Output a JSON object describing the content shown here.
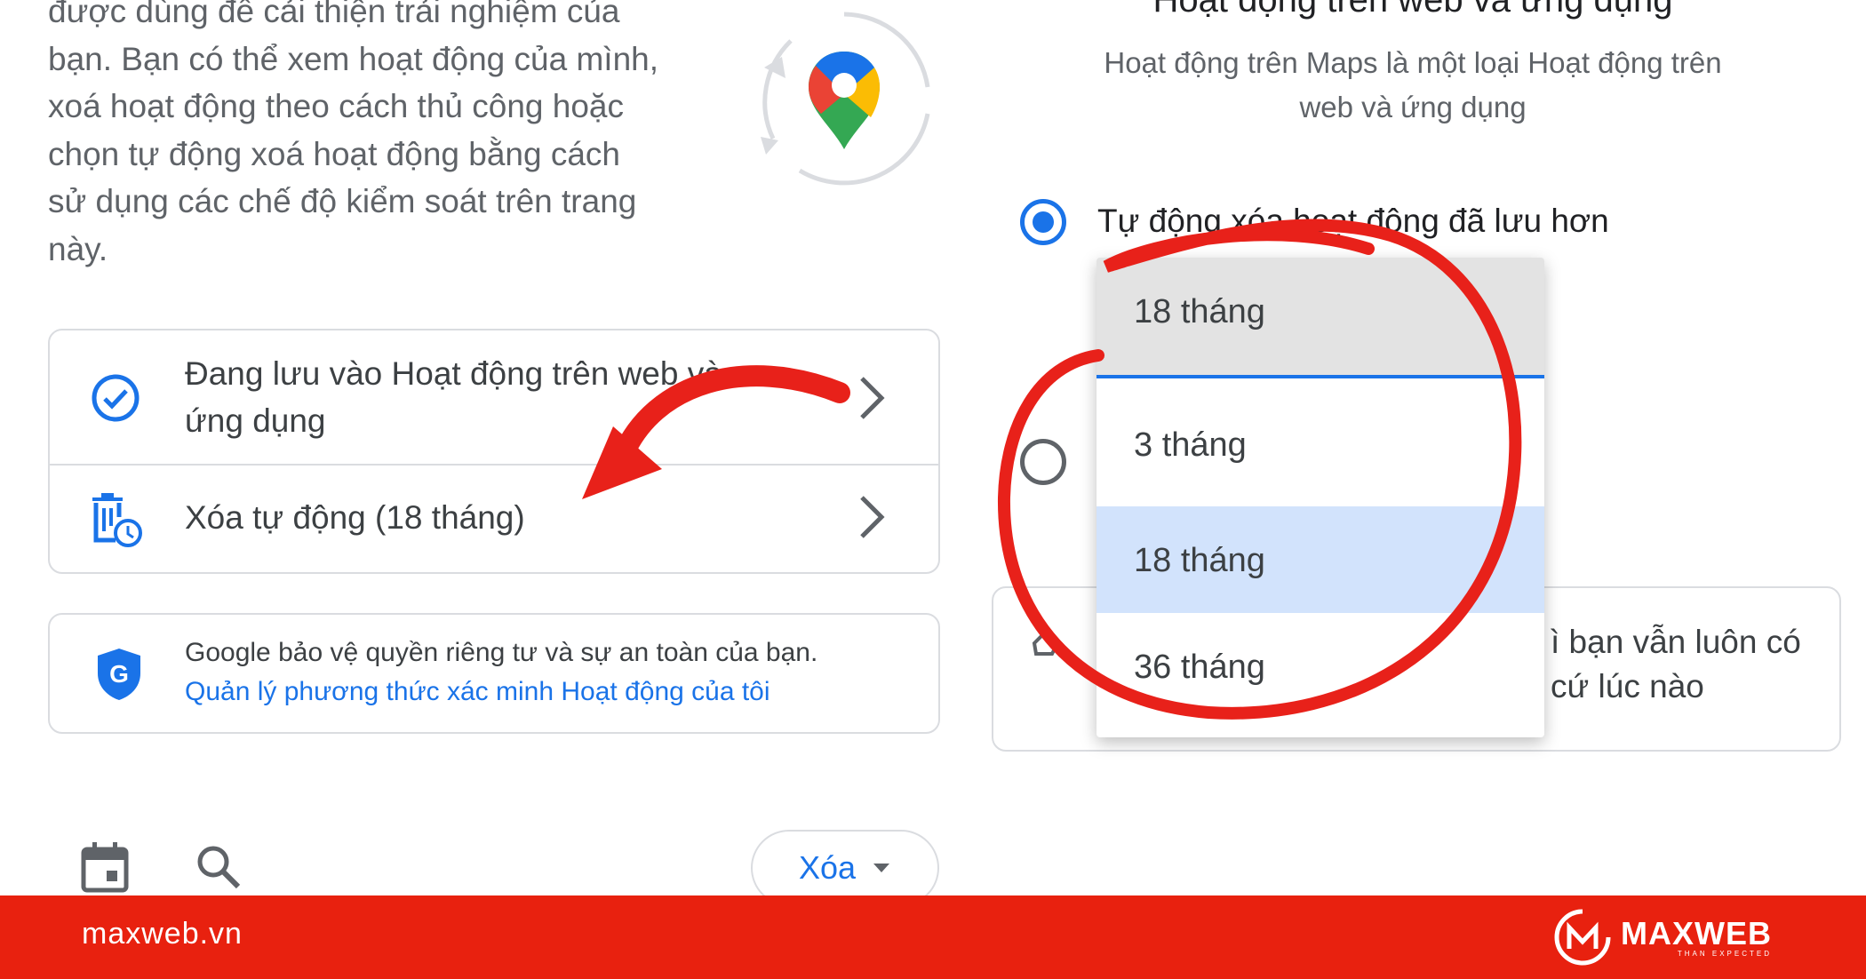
{
  "intro": {
    "text": "được dùng để cải thiện trải nghiệm của\nbạn. Bạn có thể xem hoạt động của mình,\nxoá hoạt động theo cách thủ công hoặc\nchọn tự động xoá hoạt động bằng cách\nsử dụng các chế độ kiểm soát trên trang\nnày."
  },
  "settings": {
    "rows": [
      {
        "label_line1": "Đang lưu vào Hoạt động trên web và",
        "label_line2": "ứng dụng",
        "icon": "check-circle-icon"
      },
      {
        "label": "Xóa tự động (18 tháng)",
        "icon": "auto-delete-icon"
      }
    ]
  },
  "privacy": {
    "text": "Google bảo vệ quyền riêng tư và sự an toàn của bạn.",
    "link": "Quản lý phương thức xác minh Hoạt động của tôi",
    "icon": "google-shield-icon"
  },
  "toolbar": {
    "delete_label": "Xóa",
    "icons": [
      "calendar-icon",
      "search-icon",
      "dropdown-arrow-icon"
    ]
  },
  "right": {
    "heading": "Hoạt động trên web và ứng dụng",
    "subheading": "Hoạt động trên Maps là một loại Hoạt động trên\nweb và ứng dụng",
    "radio_label": "Tự động xóa hoạt động đã lưu hơn",
    "info_text": "ì bạn vẫn luôn có\ncứ lúc nào"
  },
  "dropdown": {
    "selected_value": "18 tháng",
    "options": [
      "3 tháng",
      "18 tháng",
      "36 tháng"
    ],
    "highlighted_index": 1
  },
  "footer": {
    "domain": "maxweb.vn",
    "brand": "MAXWEB",
    "tagline": "THAN EXPECTED"
  },
  "colors": {
    "accent_blue": "#1a73e8",
    "annotation_red": "#e8211a",
    "footer_red": "#e8210f"
  }
}
